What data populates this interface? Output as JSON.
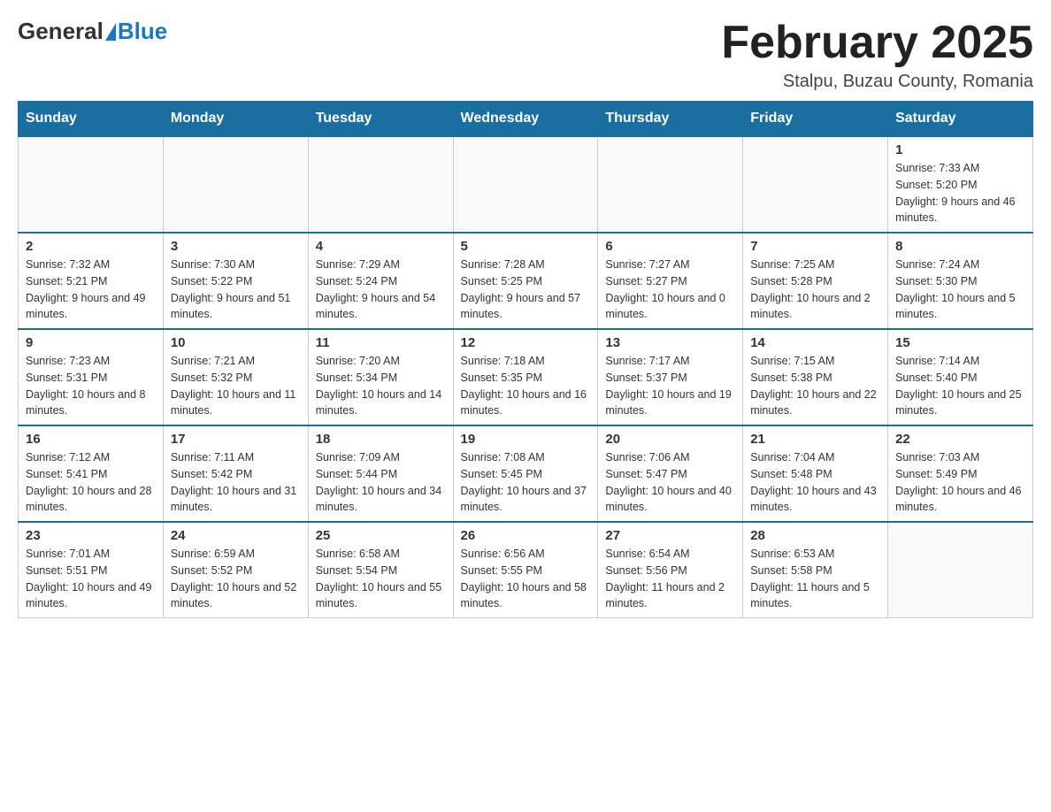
{
  "header": {
    "logo_general": "General",
    "logo_blue": "Blue",
    "month_title": "February 2025",
    "location": "Stalpu, Buzau County, Romania"
  },
  "days_of_week": [
    "Sunday",
    "Monday",
    "Tuesday",
    "Wednesday",
    "Thursday",
    "Friday",
    "Saturday"
  ],
  "weeks": [
    [
      {
        "day": "",
        "info": ""
      },
      {
        "day": "",
        "info": ""
      },
      {
        "day": "",
        "info": ""
      },
      {
        "day": "",
        "info": ""
      },
      {
        "day": "",
        "info": ""
      },
      {
        "day": "",
        "info": ""
      },
      {
        "day": "1",
        "info": "Sunrise: 7:33 AM\nSunset: 5:20 PM\nDaylight: 9 hours and 46 minutes."
      }
    ],
    [
      {
        "day": "2",
        "info": "Sunrise: 7:32 AM\nSunset: 5:21 PM\nDaylight: 9 hours and 49 minutes."
      },
      {
        "day": "3",
        "info": "Sunrise: 7:30 AM\nSunset: 5:22 PM\nDaylight: 9 hours and 51 minutes."
      },
      {
        "day": "4",
        "info": "Sunrise: 7:29 AM\nSunset: 5:24 PM\nDaylight: 9 hours and 54 minutes."
      },
      {
        "day": "5",
        "info": "Sunrise: 7:28 AM\nSunset: 5:25 PM\nDaylight: 9 hours and 57 minutes."
      },
      {
        "day": "6",
        "info": "Sunrise: 7:27 AM\nSunset: 5:27 PM\nDaylight: 10 hours and 0 minutes."
      },
      {
        "day": "7",
        "info": "Sunrise: 7:25 AM\nSunset: 5:28 PM\nDaylight: 10 hours and 2 minutes."
      },
      {
        "day": "8",
        "info": "Sunrise: 7:24 AM\nSunset: 5:30 PM\nDaylight: 10 hours and 5 minutes."
      }
    ],
    [
      {
        "day": "9",
        "info": "Sunrise: 7:23 AM\nSunset: 5:31 PM\nDaylight: 10 hours and 8 minutes."
      },
      {
        "day": "10",
        "info": "Sunrise: 7:21 AM\nSunset: 5:32 PM\nDaylight: 10 hours and 11 minutes."
      },
      {
        "day": "11",
        "info": "Sunrise: 7:20 AM\nSunset: 5:34 PM\nDaylight: 10 hours and 14 minutes."
      },
      {
        "day": "12",
        "info": "Sunrise: 7:18 AM\nSunset: 5:35 PM\nDaylight: 10 hours and 16 minutes."
      },
      {
        "day": "13",
        "info": "Sunrise: 7:17 AM\nSunset: 5:37 PM\nDaylight: 10 hours and 19 minutes."
      },
      {
        "day": "14",
        "info": "Sunrise: 7:15 AM\nSunset: 5:38 PM\nDaylight: 10 hours and 22 minutes."
      },
      {
        "day": "15",
        "info": "Sunrise: 7:14 AM\nSunset: 5:40 PM\nDaylight: 10 hours and 25 minutes."
      }
    ],
    [
      {
        "day": "16",
        "info": "Sunrise: 7:12 AM\nSunset: 5:41 PM\nDaylight: 10 hours and 28 minutes."
      },
      {
        "day": "17",
        "info": "Sunrise: 7:11 AM\nSunset: 5:42 PM\nDaylight: 10 hours and 31 minutes."
      },
      {
        "day": "18",
        "info": "Sunrise: 7:09 AM\nSunset: 5:44 PM\nDaylight: 10 hours and 34 minutes."
      },
      {
        "day": "19",
        "info": "Sunrise: 7:08 AM\nSunset: 5:45 PM\nDaylight: 10 hours and 37 minutes."
      },
      {
        "day": "20",
        "info": "Sunrise: 7:06 AM\nSunset: 5:47 PM\nDaylight: 10 hours and 40 minutes."
      },
      {
        "day": "21",
        "info": "Sunrise: 7:04 AM\nSunset: 5:48 PM\nDaylight: 10 hours and 43 minutes."
      },
      {
        "day": "22",
        "info": "Sunrise: 7:03 AM\nSunset: 5:49 PM\nDaylight: 10 hours and 46 minutes."
      }
    ],
    [
      {
        "day": "23",
        "info": "Sunrise: 7:01 AM\nSunset: 5:51 PM\nDaylight: 10 hours and 49 minutes."
      },
      {
        "day": "24",
        "info": "Sunrise: 6:59 AM\nSunset: 5:52 PM\nDaylight: 10 hours and 52 minutes."
      },
      {
        "day": "25",
        "info": "Sunrise: 6:58 AM\nSunset: 5:54 PM\nDaylight: 10 hours and 55 minutes."
      },
      {
        "day": "26",
        "info": "Sunrise: 6:56 AM\nSunset: 5:55 PM\nDaylight: 10 hours and 58 minutes."
      },
      {
        "day": "27",
        "info": "Sunrise: 6:54 AM\nSunset: 5:56 PM\nDaylight: 11 hours and 2 minutes."
      },
      {
        "day": "28",
        "info": "Sunrise: 6:53 AM\nSunset: 5:58 PM\nDaylight: 11 hours and 5 minutes."
      },
      {
        "day": "",
        "info": ""
      }
    ]
  ]
}
